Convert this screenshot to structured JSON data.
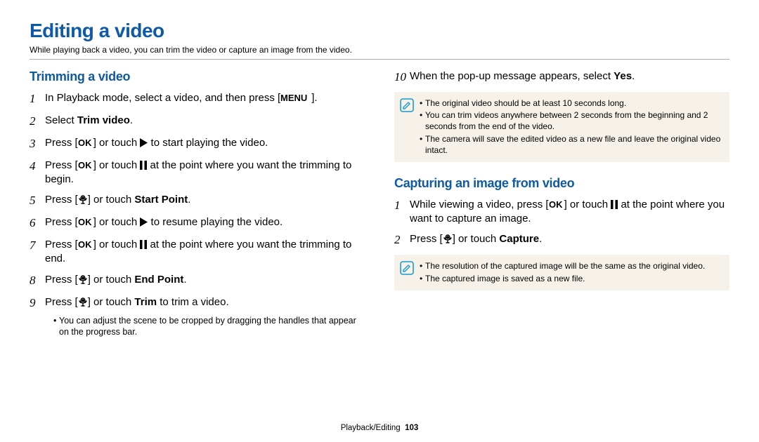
{
  "page": {
    "title": "Editing a video",
    "subtitle": "While playing back a video, you can trim the video or capture an image from the video."
  },
  "left": {
    "heading": "Trimming a video",
    "steps": [
      {
        "n": "1",
        "pre": "In Playback mode, select a video, and then press [",
        "icon": "menu",
        "post": "]."
      },
      {
        "n": "2",
        "pre": "Select ",
        "bold": "Trim video",
        "post": "."
      },
      {
        "n": "3",
        "pre": "Press [",
        "icon": "ok",
        "mid": "] or touch ",
        "icon2": "play",
        "post": " to start playing the video."
      },
      {
        "n": "4",
        "pre": "Press [",
        "icon": "ok",
        "mid": "] or touch ",
        "icon2": "pause",
        "post": " at the point where you want the trimming to begin."
      },
      {
        "n": "5",
        "pre": "Press [",
        "icon": "macro",
        "mid": "] or touch ",
        "bold": "Start Point",
        "post": "."
      },
      {
        "n": "6",
        "pre": "Press [",
        "icon": "ok",
        "mid": "] or touch ",
        "icon2": "play",
        "post": " to resume playing the video."
      },
      {
        "n": "7",
        "pre": "Press [",
        "icon": "ok",
        "mid": "] or touch ",
        "icon2": "pause",
        "post": " at the point where you want the trimming to end."
      },
      {
        "n": "8",
        "pre": "Press [",
        "icon": "macro",
        "mid": "] or touch ",
        "bold": "End Point",
        "post": "."
      },
      {
        "n": "9",
        "pre": "Press [",
        "icon": "macro",
        "mid": "] or touch ",
        "bold": "Trim",
        "post": " to trim a video."
      }
    ],
    "sub_bullet": "You can adjust the scene to be cropped by dragging the handles that appear on the progress bar."
  },
  "right": {
    "step10": {
      "n": "10",
      "pre": "When the pop-up message appears, select ",
      "bold": "Yes",
      "post": "."
    },
    "note1": [
      "The original video should be at least 10 seconds long.",
      "You can trim videos anywhere between 2 seconds from the beginning and 2 seconds from the end of the video.",
      "The camera will save the edited video as a new file and leave the original video intact."
    ],
    "heading2": "Capturing an image from video",
    "cap_steps": [
      {
        "n": "1",
        "pre": "While viewing a video, press [",
        "icon": "ok",
        "mid": "] or touch ",
        "icon2": "pause",
        "post": " at the point where you want to capture an image."
      },
      {
        "n": "2",
        "pre": "Press [",
        "icon": "macro",
        "mid": "] or touch ",
        "bold": "Capture",
        "post": "."
      }
    ],
    "note2": [
      "The resolution of the captured image will be the same as the original video.",
      "The captured image is saved as a new file."
    ]
  },
  "footer": {
    "section": "Playback/Editing",
    "page": "103"
  }
}
